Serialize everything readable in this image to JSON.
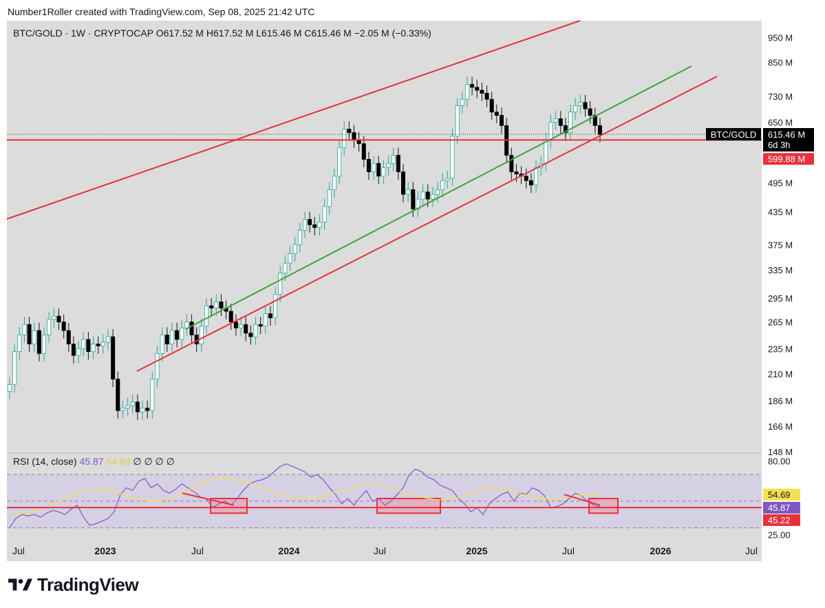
{
  "header": {
    "created": "Number1Roller created with TradingView.com, Sep 08, 2025 21:42 UTC"
  },
  "symbol_line": {
    "symbol": "BTC/GOLD · 1W · CRYPTOCAP",
    "open_label": "O",
    "open": "617.52 M",
    "high_label": "H",
    "high": "617.52 M",
    "low_label": "L",
    "low": "615.46 M",
    "close_label": "C",
    "close": "615.46 M",
    "change": "−2.05 M (−0.33%)"
  },
  "price_tag": {
    "symbol": "BTC/GOLD",
    "value": "615.46 M",
    "countdown": "6d 3h"
  },
  "level_tag": {
    "value": "599.88 M"
  },
  "rsi_legend": {
    "title": "RSI (14, close)",
    "rsi": "45.87",
    "ma": "54.69",
    "empties": "∅ ∅ ∅ ∅"
  },
  "rsi_tags": {
    "ma": "54.69",
    "rsi": "45.87",
    "level": "45.22"
  },
  "colors": {
    "background": "#dcdcdc",
    "up": "#ffffff",
    "up_border": "#26a69a",
    "down": "#000000",
    "red_line": "#e8313b",
    "green_line": "#3fa33f",
    "rsi_line": "#7e57c2",
    "rsi_ma": "#f5e050",
    "rsi_band": "#d6d0e4",
    "rsi_box": "#e6a9b8"
  },
  "brand": {
    "name": "TradingView"
  },
  "chart_data": {
    "type": "candlestick",
    "title": "BTC/GOLD · 1W · CRYPTOCAP",
    "y_scale": "log",
    "ylim": [
      148,
      1000
    ],
    "y_ticks": [
      "950 M",
      "850 M",
      "730 M",
      "650 M",
      "495 M",
      "435 M",
      "375 M",
      "335 M",
      "295 M",
      "265 M",
      "235 M",
      "210 M",
      "186 M",
      "166 M",
      "148 M"
    ],
    "x_ticks": [
      "Jul",
      "2023",
      "Jul",
      "2024",
      "Jul",
      "2025",
      "Jul",
      "2026",
      "Jul"
    ],
    "x_range": [
      "2022-06",
      "2026-07"
    ],
    "close_prices_M": [
      200,
      232,
      250,
      262,
      240,
      255,
      230,
      250,
      268,
      272,
      265,
      255,
      240,
      228,
      235,
      245,
      232,
      240,
      238,
      242,
      248,
      205,
      178,
      180,
      182,
      185,
      177,
      180,
      178,
      205,
      230,
      250,
      240,
      255,
      245,
      258,
      265,
      250,
      240,
      260,
      285,
      282,
      290,
      282,
      278,
      265,
      258,
      262,
      252,
      248,
      262,
      260,
      275,
      270,
      300,
      330,
      345,
      360,
      375,
      400,
      420,
      410,
      405,
      415,
      445,
      480,
      510,
      580,
      630,
      620,
      600,
      590,
      550,
      520,
      540,
      510,
      530,
      540,
      560,
      520,
      470,
      480,
      440,
      460,
      475,
      460,
      470,
      480,
      500,
      505,
      610,
      700,
      720,
      770,
      760,
      750,
      740,
      720,
      680,
      670,
      640,
      560,
      520,
      515,
      510,
      500,
      490,
      530,
      540,
      600,
      650,
      660,
      640,
      620,
      680,
      700,
      710,
      690,
      670,
      640,
      615
    ],
    "horizontal_level_M": 599.88,
    "last_close_M": 615.46,
    "rsi": {
      "period": 14,
      "ylim": [
        20,
        85
      ],
      "y_ticks": [
        "80.00",
        "25.00"
      ],
      "band": [
        30,
        70
      ],
      "last_rsi": 45.87,
      "last_ma": 54.69,
      "level": 45.22,
      "values": [
        30,
        37,
        40,
        39,
        40,
        38,
        41,
        43,
        42,
        40,
        44,
        47,
        38,
        32,
        33,
        35,
        37,
        42,
        55,
        60,
        58,
        65,
        67,
        60,
        63,
        58,
        56,
        59,
        63,
        60,
        57,
        53,
        52,
        45,
        48,
        50,
        47,
        52,
        58,
        63,
        65,
        66,
        68,
        72,
        76,
        78,
        76,
        74,
        72,
        68,
        70,
        66,
        60,
        55,
        48,
        52,
        47,
        53,
        58,
        50,
        52,
        47,
        50,
        55,
        60,
        70,
        74,
        72,
        68,
        66,
        62,
        60,
        58,
        52,
        48,
        42,
        45,
        40,
        48,
        52,
        55,
        57,
        50,
        56,
        55,
        60,
        58,
        54,
        45,
        46,
        48,
        52,
        56,
        54,
        50,
        47,
        45.87
      ],
      "ma_values": [
        40,
        40,
        41,
        42,
        44,
        46,
        49,
        52,
        55,
        57,
        58,
        59,
        59,
        58,
        56,
        54,
        52,
        51,
        50,
        50,
        51,
        52,
        55,
        58,
        61,
        64,
        66,
        67,
        67,
        66,
        65,
        63,
        61,
        59,
        57,
        55,
        53,
        52,
        51,
        52,
        53,
        55,
        57,
        58,
        60,
        62,
        63,
        63,
        62,
        60,
        58,
        56,
        55,
        53,
        52,
        51,
        51,
        52,
        53,
        55,
        57,
        59,
        60,
        60,
        59,
        57,
        55,
        54,
        53,
        52,
        51,
        52,
        53,
        54,
        55,
        55,
        54.69
      ]
    }
  }
}
